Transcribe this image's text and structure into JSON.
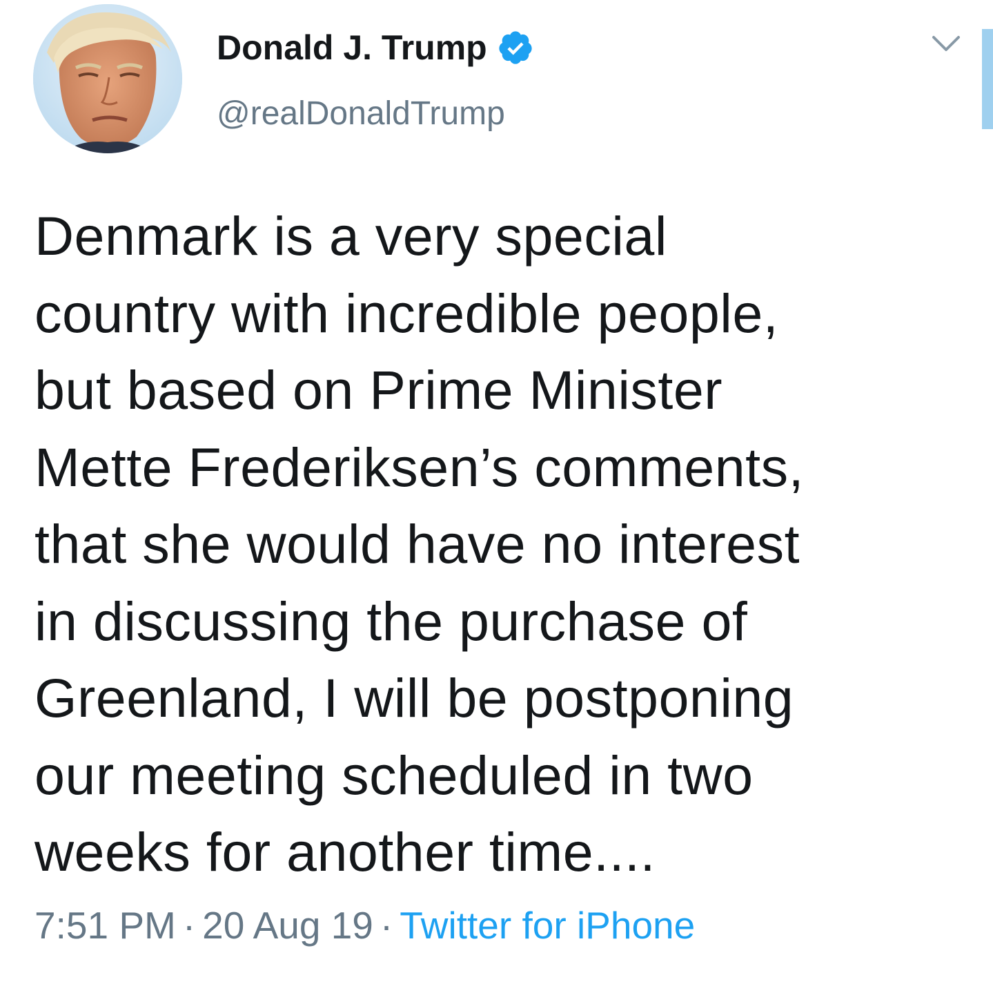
{
  "author": {
    "display_name": "Donald J. Trump",
    "handle": "@realDonaldTrump",
    "verified": true,
    "verified_icon": "verified-badge-icon",
    "avatar_icon": "profile-avatar"
  },
  "tweet": {
    "lines": [
      "Denmark is a very special",
      "country with incredible people,",
      "but based on Prime Minister",
      "Mette Frederiksen’s comments,",
      "that she would have no interest",
      "in discussing the purchase of",
      "Greenland, I will be postponing",
      "our meeting scheduled in two",
      "weeks for another time...."
    ]
  },
  "meta": {
    "time": "7:51 PM",
    "date": "20 Aug 19",
    "separator": "·",
    "source": "Twitter for iPhone"
  },
  "colors": {
    "text": "#14171a",
    "secondary": "#657786",
    "accent": "#1da1f2"
  }
}
